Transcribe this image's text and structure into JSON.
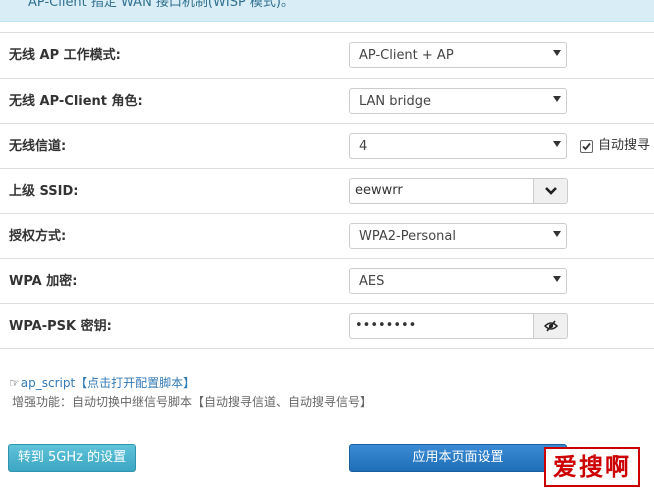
{
  "banner": {
    "text": "AP-Client 指定 WAN 接口机制(WISP 模式)。"
  },
  "rows": [
    {
      "label": "无线 AP 工作模式:",
      "value": "AP-Client + AP"
    },
    {
      "label": "无线 AP-Client 角色:",
      "value": "LAN bridge"
    },
    {
      "label": "无线信道:",
      "value": "4",
      "checkbox_label": "自动搜寻",
      "checkbox_checked": true
    },
    {
      "label": "上级 SSID:",
      "value": "eewwrr"
    },
    {
      "label": "授权方式:",
      "value": "WPA2-Personal"
    },
    {
      "label": "WPA 加密:",
      "value": "AES"
    },
    {
      "label": "WPA-PSK 密钥:",
      "value": "••••••••"
    }
  ],
  "script": {
    "hand": "☞",
    "link_text": "ap_script【点击打开配置脚本】",
    "enhance_text": "增强功能：自动切换中继信号脚本【自动搜寻信道、自动搜寻信号】"
  },
  "buttons": {
    "switch_5g": "转到 5GHz 的设置",
    "apply": "应用本页面设置"
  },
  "watermark": {
    "text": "爱搜啊"
  },
  "colors": {
    "accent": "#1f6fb8",
    "info": "#5fc3d9",
    "watermark": "#cc0000"
  }
}
